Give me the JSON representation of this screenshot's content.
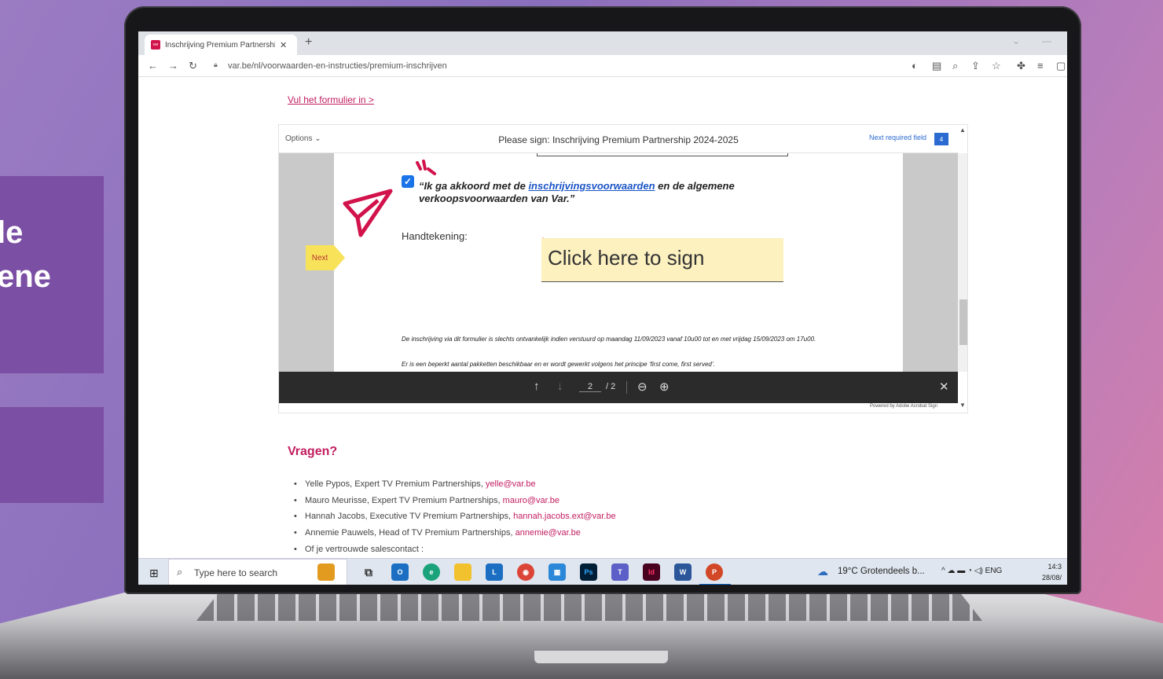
{
  "side": {
    "line1": "le",
    "line2": "ene"
  },
  "browser": {
    "tab_title": "Inschrijving Premium Partnership",
    "favicon_text": "var",
    "url": "var.be/nl/voorwaarden-en-instructies/premium-inschrijven"
  },
  "page": {
    "form_link": "Vul het formulier in >",
    "pdf": {
      "options": "Options",
      "title": "Please sign: Inschrijving Premium Partnership 2024-2025",
      "next_required": "Next required field",
      "next_required_count": "4",
      "agree_pre": "“Ik ga akkoord met de ",
      "agree_link": "inschrijvingsvoorwaarden",
      "agree_post": " en de algemene verkoopsvoorwaarden van Var.”",
      "handtekening": "Handtekening:",
      "required_star": "*",
      "sign_text": "Click here to sign",
      "next_tag": "Next",
      "notice1": "De inschrijving via dit formulier is slechts ontvankelijk indien verstuurd op maandag 11/09/2023 vanaf 10u00 tot en met vrijdag 15/09/2023 om 17u00.",
      "notice2": "Er is een beperkt aantal pakketten beschikbaar en er wordt gewerkt volgens het principe ‘first come, first served’.",
      "page_current": "2",
      "page_total": "/ 2",
      "powered": "Powered by Adobe Acrobat Sign"
    },
    "vragen": "Vragen?",
    "contacts": [
      {
        "text": "Yelle Pypos, Expert TV Premium Partnerships, ",
        "email": "yelle@var.be"
      },
      {
        "text": "Mauro Meurisse, Expert TV Premium Partnerships, ",
        "email": "mauro@var.be"
      },
      {
        "text": "Hannah Jacobs, Executive TV Premium Partnerships, ",
        "email": "hannah.jacobs.ext@var.be"
      },
      {
        "text": "Annemie Pauwels, Head of TV Premium Partnerships, ",
        "email": "annemie@var.be"
      },
      {
        "text": "Of je vertrouwde salescontact :",
        "email": ""
      }
    ]
  },
  "taskbar": {
    "search_placeholder": "Type here to search",
    "weather": "19°C  Grotendeels b...",
    "lang": "ENG",
    "time": "14:3",
    "date": "28/08/"
  },
  "colors": {
    "brand": "#c21d5f",
    "accent": "#2a6ad1",
    "sign_bg": "#fdf1c0",
    "side_card": "#7b4fa3"
  }
}
